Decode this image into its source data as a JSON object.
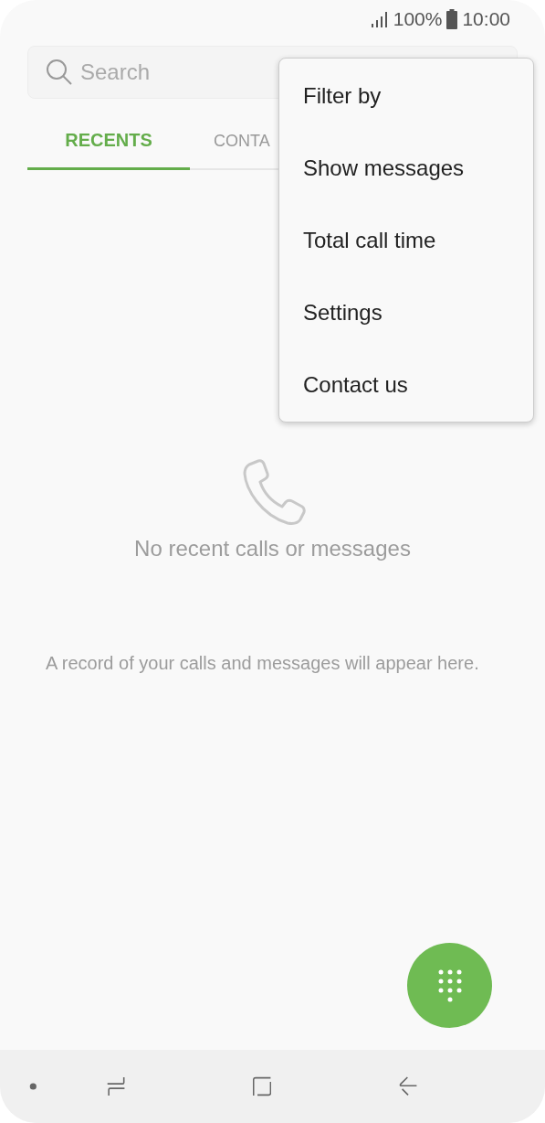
{
  "status_bar": {
    "battery": "100%",
    "time": "10:00"
  },
  "search": {
    "placeholder": "Search"
  },
  "tabs": [
    {
      "label": "RECENTS",
      "selected": true
    },
    {
      "label": "CONTA",
      "selected": false
    }
  ],
  "menu": {
    "items": [
      "Filter by",
      "Show messages",
      "Total call time",
      "Settings",
      "Contact us"
    ]
  },
  "empty_state": {
    "title": "No recent calls or messages",
    "hint": "A record of your calls and messages will appear here."
  }
}
